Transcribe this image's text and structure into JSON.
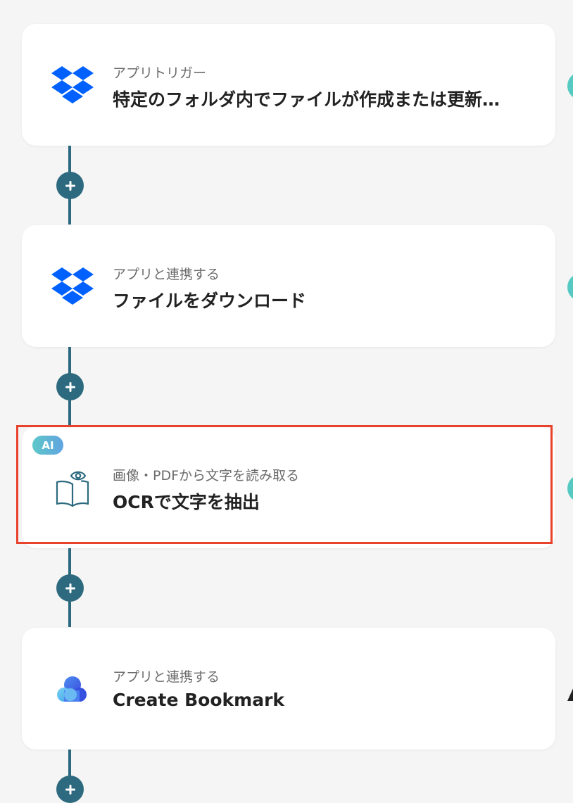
{
  "flow": {
    "steps": [
      {
        "category": "アプリトリガー",
        "title": "特定のフォルダ内でファイルが作成または更新されたら",
        "app_icon": "dropbox-icon"
      },
      {
        "category": "アプリと連携する",
        "title": "ファイルをダウンロード",
        "app_icon": "dropbox-icon"
      },
      {
        "badge": "AI",
        "category": "画像・PDFから文字を読み取る",
        "title": "OCRで文字を抽出",
        "app_icon": "ocr-book-eye-icon",
        "selected": true
      },
      {
        "category": "アプリと連携する",
        "title": "Create Bookmark",
        "app_icon": "cloud-app-icon"
      }
    ],
    "add_button_icon": "plus-icon"
  },
  "colors": {
    "background": "#f5f5f5",
    "connector": "#2d6a7f",
    "highlight": "#e8412c",
    "dropbox": "#0061fe",
    "ai_badge": "#5ec8c9"
  }
}
